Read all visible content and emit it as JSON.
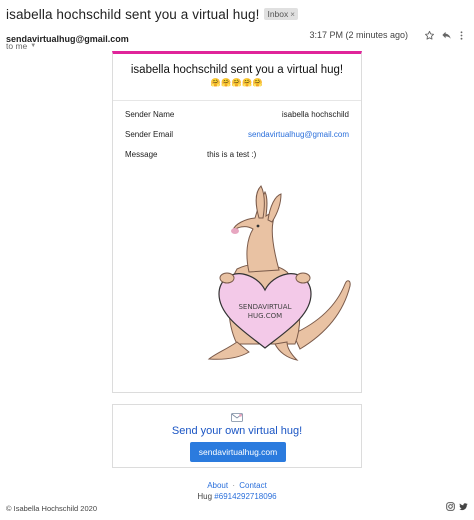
{
  "email": {
    "subject": "isabella hochschild sent you a virtual hug!",
    "label_badge": "Inbox",
    "label_badge_close": "×",
    "sender": "sendavirtualhug@gmail.com",
    "timestamp": "3:17 PM (2 minutes ago)",
    "to": "to me"
  },
  "icons": {
    "star": "star-icon",
    "reply": "reply-icon",
    "more": "more-vertical-icon",
    "envelope": "envelope-icon",
    "instagram": "instagram-icon",
    "twitter": "twitter-icon"
  },
  "card": {
    "title": "isabella hochschild sent you a virtual hug!",
    "emojis": "🤗🤗🤗🤗🤗",
    "fields": [
      {
        "label": "Sender Name",
        "value": "isabella hochschild"
      },
      {
        "label": "Sender Email",
        "value": "sendavirtualhug@gmail.com"
      },
      {
        "label": "Message",
        "value": "this is a test :)"
      }
    ],
    "illustration_text_line1": "SENDAVIRTUAL",
    "illustration_text_line2": "HUG.COM",
    "accent_color": "#e0249a"
  },
  "cta": {
    "title": "Send your own virtual hug!",
    "button_label": "sendavirtualhug.com"
  },
  "footer": {
    "about": "About",
    "separator": "·",
    "contact": "Contact",
    "hug_prefix": "Hug ",
    "hug_id": "#6914292718096",
    "copyright": "© Isabella Hochschild 2020"
  }
}
